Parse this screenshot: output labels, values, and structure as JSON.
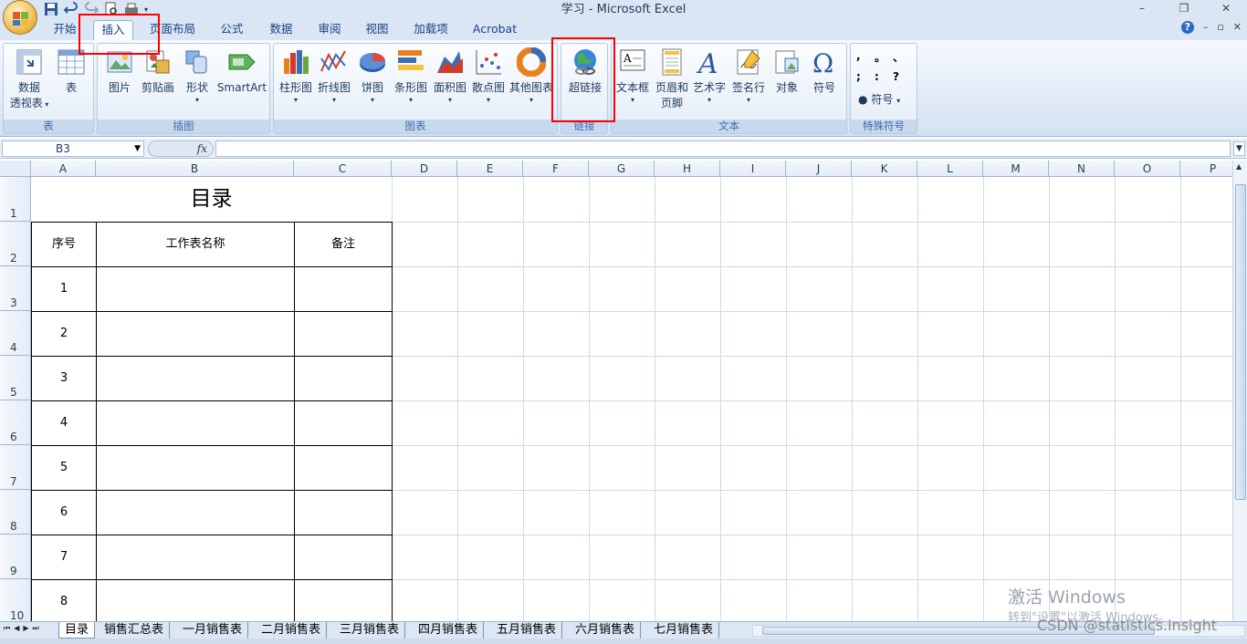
{
  "app": {
    "title": "学习 - Microsoft Excel"
  },
  "window_controls": [
    "–",
    "❐",
    "✕"
  ],
  "doc_controls": [
    "?",
    "–",
    "▫",
    "✕"
  ],
  "tabs": [
    {
      "label": "开始"
    },
    {
      "label": "插入"
    },
    {
      "label": "页面布局"
    },
    {
      "label": "公式"
    },
    {
      "label": "数据"
    },
    {
      "label": "审阅"
    },
    {
      "label": "视图"
    },
    {
      "label": "加载项"
    },
    {
      "label": "Acrobat"
    }
  ],
  "ribbon": {
    "groups": {
      "table": "表",
      "illustrations": "插图",
      "charts": "图表",
      "links": "链接",
      "text": "文本",
      "special_symbols": "特殊符号"
    },
    "buttons": {
      "pivot_line1": "数据",
      "pivot_line2": "透视表",
      "table": "表",
      "picture": "图片",
      "clipart": "剪贴画",
      "shapes": "形状",
      "smartart": "SmartArt",
      "column": "柱形图",
      "line": "折线图",
      "pie": "饼图",
      "bar": "条形图",
      "area": "面积图",
      "scatter": "散点图",
      "other": "其他图表",
      "hyperlink": "超链接",
      "textbox": "文本框",
      "header_line1": "页眉和",
      "header_line2": "页脚",
      "wordart": "艺术字",
      "signature": "签名行",
      "object": "对象",
      "symbol": "符号",
      "special_symbol": "符号"
    },
    "special_chars": [
      ",",
      "。",
      "、",
      ";",
      ":",
      "?"
    ]
  },
  "formula_bar": {
    "name_box": "B3",
    "fx": "fx",
    "formula": ""
  },
  "columns": [
    "A",
    "B",
    "C",
    "D",
    "E",
    "F",
    "G",
    "H",
    "I",
    "J",
    "K",
    "L",
    "M",
    "N",
    "O",
    "P"
  ],
  "rows": [
    "1",
    "2",
    "3",
    "4",
    "5",
    "6",
    "7",
    "8",
    "9",
    "10"
  ],
  "sheet_content": {
    "title": "目录",
    "headers": [
      "序号",
      "工作表名称",
      "备注"
    ],
    "numbers": [
      "1",
      "2",
      "3",
      "4",
      "5",
      "6",
      "7",
      "8"
    ]
  },
  "sheet_tabs": [
    "目录",
    "销售汇总表",
    "一月销售表",
    "二月销售表",
    "三月销售表",
    "四月销售表",
    "五月销售表",
    "六月销售表",
    "七月销售表"
  ],
  "overlays": {
    "activate_windows": "激活 Windows",
    "activate_windows_sub": "转到\"设置\"以激活 Windows。",
    "csdn": "CSDN @statistics.insight"
  }
}
